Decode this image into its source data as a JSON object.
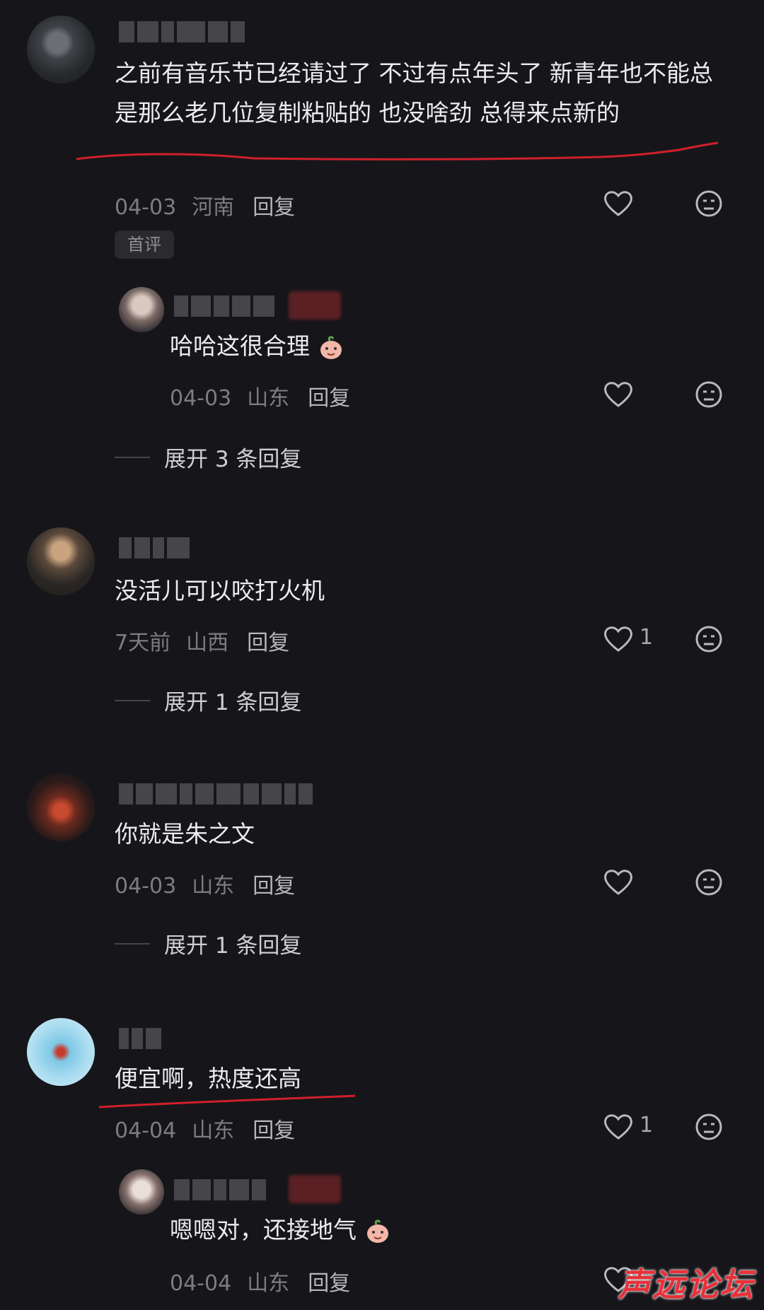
{
  "comments": [
    {
      "text": "之前有音乐节已经请过了 不过有点年头了  新青年也不能总是那么老几位复制粘贴的 也没啥劲 总得来点新的",
      "date": "04-03",
      "location": "河南",
      "reply_label": "回复",
      "badge": "首评",
      "reply": {
        "text": "哈哈这很合理",
        "date": "04-03",
        "location": "山东",
        "reply_label": "回复"
      },
      "expand_label": "展开 3 条回复"
    },
    {
      "text": "没活儿可以咬打火机",
      "date": "7天前",
      "location": "山西",
      "reply_label": "回复",
      "likes": "1",
      "expand_label": "展开 1 条回复"
    },
    {
      "text": "你就是朱之文",
      "date": "04-03",
      "location": "山东",
      "reply_label": "回复",
      "expand_label": "展开 1 条回复"
    },
    {
      "text": "便宜啊，热度还高",
      "date": "04-04",
      "location": "山东",
      "reply_label": "回复",
      "likes": "1",
      "reply": {
        "text": "嗯嗯对，还接地气",
        "date": "04-04",
        "location": "山东",
        "reply_label": "回复"
      }
    }
  ],
  "watermark": "声远论坛",
  "colors": {
    "background": "#16161a",
    "annotation_red": "#d0202a"
  },
  "icons": [
    "heart-icon",
    "dislike-face-icon",
    "peach-emoji-icon"
  ]
}
